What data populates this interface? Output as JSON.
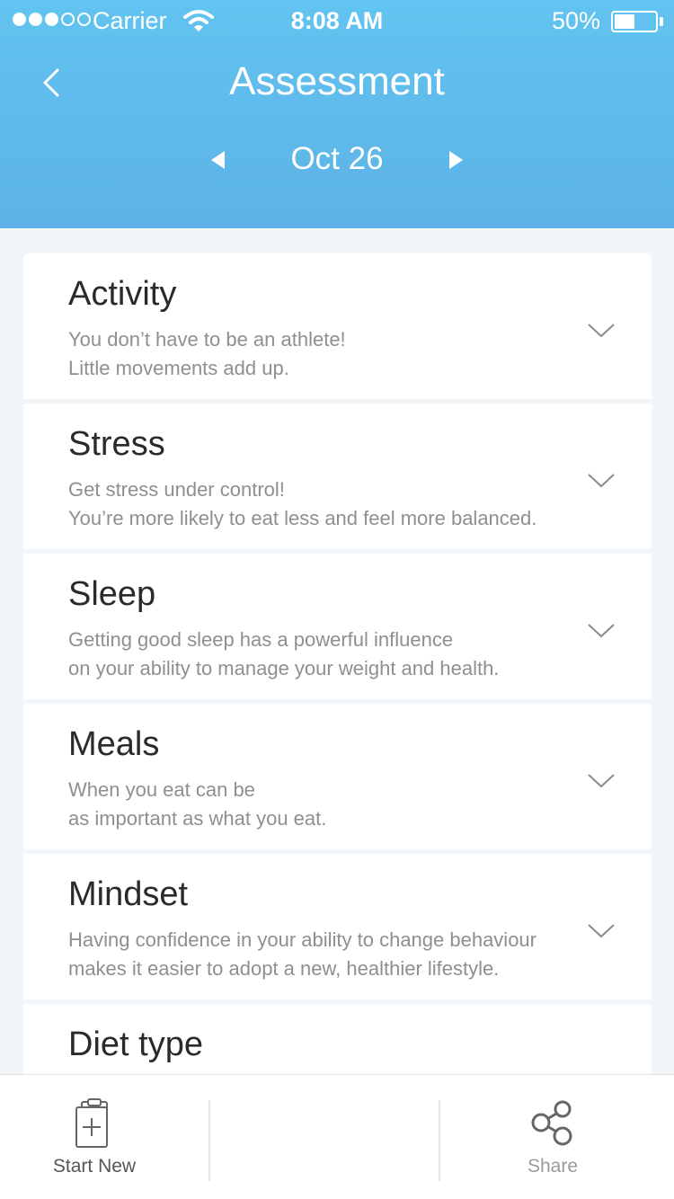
{
  "status_bar": {
    "carrier": "Carrier",
    "time": "8:08 AM",
    "battery_percent": "50%",
    "battery_level": 0.5,
    "signal_filled": 3,
    "signal_total": 5
  },
  "header": {
    "title": "Assessment",
    "date": "Oct 26",
    "color": "#5cbbef"
  },
  "categories": [
    {
      "title": "Activity",
      "lines": [
        "You don’t have to be an athlete!",
        "Little movements add up."
      ]
    },
    {
      "title": "Stress",
      "lines": [
        "Get stress under control!",
        "You’re more likely to eat less and feel more balanced."
      ]
    },
    {
      "title": "Sleep",
      "lines": [
        "Getting good sleep has a powerful influence",
        "on your ability to manage your weight and  health."
      ]
    },
    {
      "title": "Meals",
      "lines": [
        "When you eat can be",
        "as important as what you eat."
      ]
    },
    {
      "title": "Mindset",
      "lines": [
        "Having confidence in your ability to change behaviour",
        "makes it easier to adopt a new, healthier lifestyle."
      ]
    },
    {
      "title": "Diet type",
      "lines": [
        "",
        ""
      ]
    }
  ],
  "toolbar": {
    "start_new_label": "Start New",
    "share_label": "Share"
  }
}
